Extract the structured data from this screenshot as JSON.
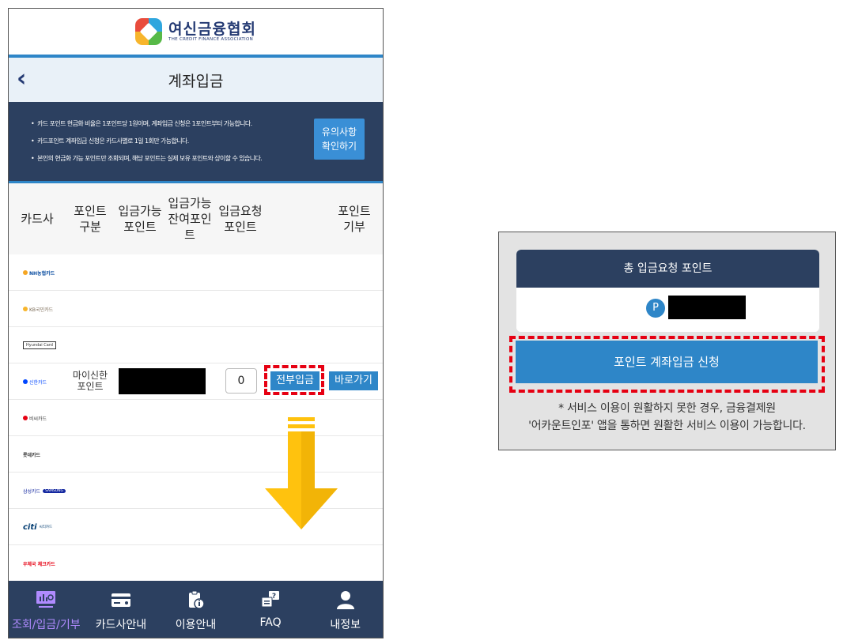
{
  "header": {
    "org_name": "여신금융협회",
    "org_name_en": "THE CREDIT FINANCE ASSOCIATION",
    "page_title": "계좌입금"
  },
  "notice": {
    "items": [
      "카드 포인트 현금화 비율은 1포인트당 1원이며, 계좌입금 신청은 1포인트부터 가능합니다.",
      "카드포인트 계좌입금 신청은 카드사별로 1일 1회만 가능합니다.",
      "본인의 현금화 가능 포인트만 조회되며, 해당 포인트는 실제 보유 포인트와 상이할 수 있습니다."
    ],
    "button_line1": "유의사항",
    "button_line2": "확인하기"
  },
  "table": {
    "headers": {
      "card_company": "카드사",
      "point_type_1": "포인트",
      "point_type_2": "구분",
      "available_1": "입금가능",
      "available_2": "포인트",
      "remaining_1": "입금가능",
      "remaining_2": "잔여포인",
      "remaining_3": "트",
      "request_1": "입금요청",
      "request_2": "포인트",
      "donate_1": "포인트",
      "donate_2": "기부"
    },
    "cards": {
      "nh": "NH농협카드",
      "kb": "KB국민카드",
      "hyundai": "Hyundai Card",
      "shinhan": "신한카드",
      "bc": "비씨카드",
      "lotte": "롯데카드",
      "samsung_ko": "삼성카드",
      "samsung_en": "SAMSUNG",
      "citi_logo": "citi",
      "citi_ko": "씨티카드",
      "post": "우체국 체크카드"
    },
    "shinhan_row": {
      "point_type_1": "마이신한",
      "point_type_2": "포인트",
      "request_value": "0",
      "deposit_all_label": "전부입금",
      "go_label": "바로가기"
    }
  },
  "nav": {
    "items": [
      {
        "label": "조회/입금/기부",
        "icon": "inquiry-icon"
      },
      {
        "label": "카드사안내",
        "icon": "card-icon"
      },
      {
        "label": "이용안내",
        "icon": "info-icon"
      },
      {
        "label": "FAQ",
        "icon": "faq-icon"
      },
      {
        "label": "내정보",
        "icon": "user-icon"
      }
    ]
  },
  "summary": {
    "title": "총 입금요청 포인트",
    "point_badge": "P",
    "apply_label": "포인트 계좌입금 신청",
    "footnote_line1": "* 서비스 이용이 원활하지 못한 경우, 금융결제원",
    "footnote_line2": "'어카운트인포' 앱을 통하면 원활한 서비스 이용이 가능합니다."
  },
  "colors": {
    "navy": "#2c4060",
    "blue": "#2e86c8",
    "highlight": "#e60012",
    "arrow": "#ffc20e",
    "active_nav": "#b08bff"
  }
}
